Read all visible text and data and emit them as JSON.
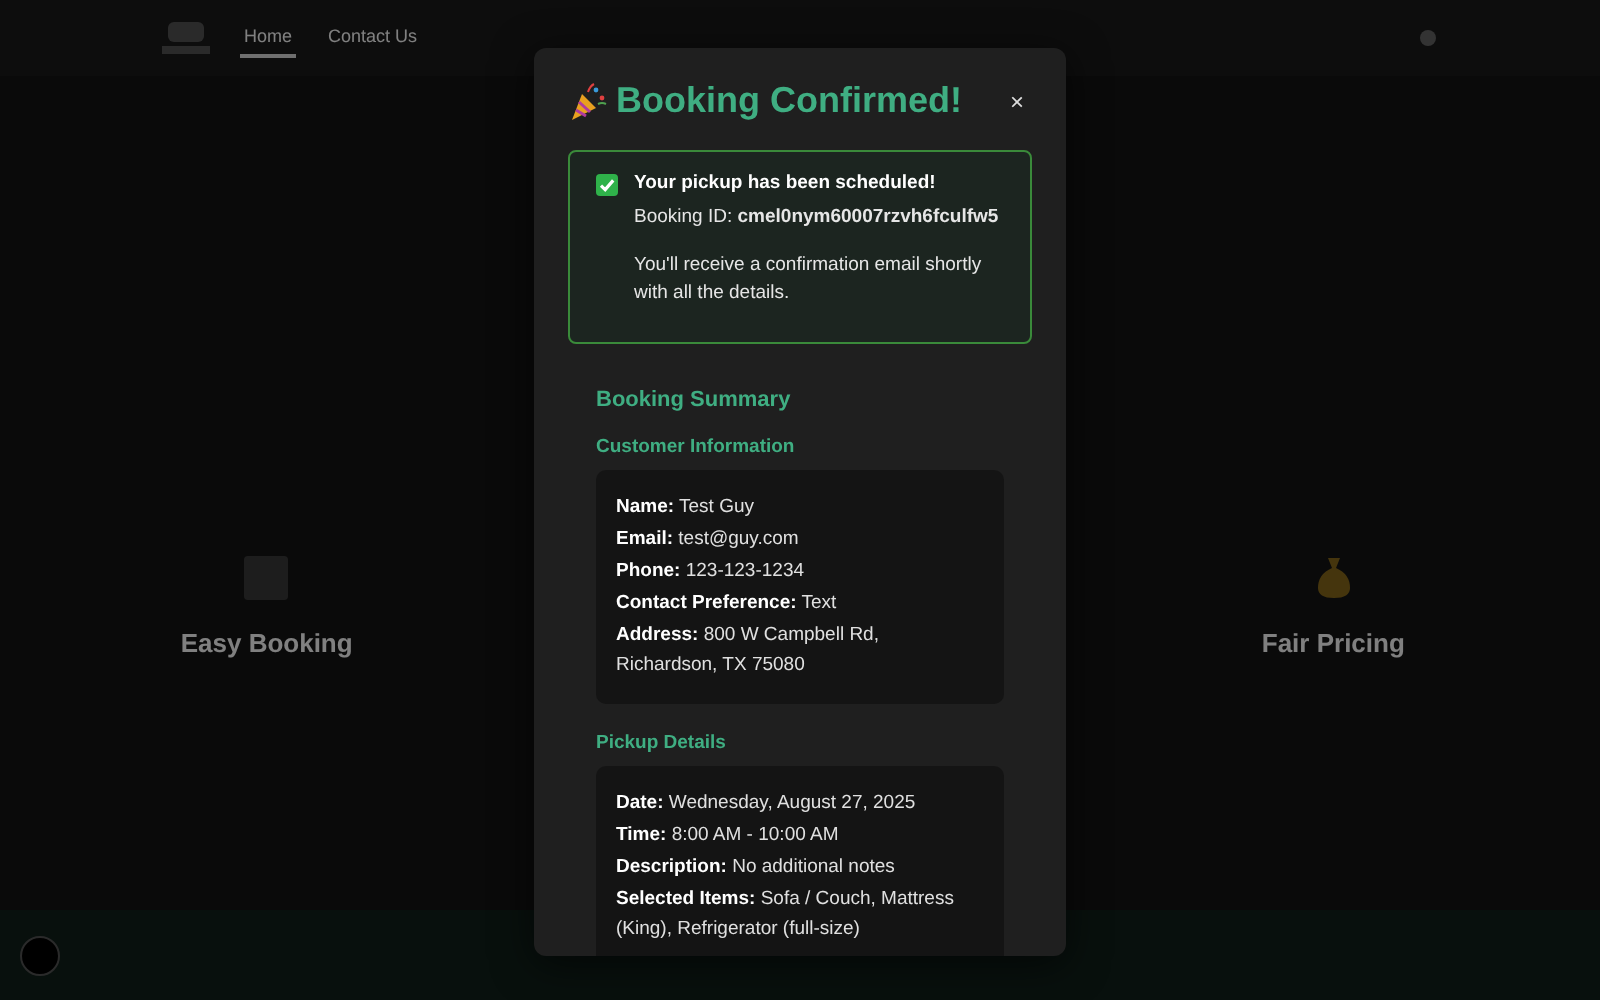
{
  "nav": {
    "links": [
      {
        "label": "Home",
        "selected": true
      },
      {
        "label": "Contact Us",
        "selected": false
      }
    ]
  },
  "features": [
    {
      "kind": "box",
      "title": "Easy Booking"
    },
    {
      "kind": "money",
      "title": "Fair Pricing"
    }
  ],
  "modal": {
    "title": "Booking Confirmed!",
    "close": "×",
    "alert": {
      "heading": "Your pickup has been scheduled!",
      "id_label": "Booking ID:",
      "id": "cmel0nym60007rzvh6fculfw5",
      "note": "You'll receive a confirmation email shortly with all the details."
    },
    "summary_title": "Booking Summary",
    "sections": [
      {
        "title": "Customer Information",
        "fields": [
          {
            "label": "Name:",
            "value": "Test Guy"
          },
          {
            "label": "Email:",
            "value": "test@guy.com"
          },
          {
            "label": "Phone:",
            "value": "123-123-1234"
          },
          {
            "label": "Contact Preference:",
            "value": "Text"
          },
          {
            "label": "Address:",
            "value": "800 W Campbell Rd, Richardson, TX 75080"
          }
        ]
      },
      {
        "title": "Pickup Details",
        "fields": [
          {
            "label": "Date:",
            "value": "Wednesday, August 27, 2025"
          },
          {
            "label": "Time:",
            "value": "8:00 AM - 10:00 AM"
          },
          {
            "label": "Description:",
            "value": "No additional notes"
          },
          {
            "label": "Selected Items:",
            "value": "Sofa / Couch, Mattress (King), Refrigerator (full-size)"
          }
        ]
      }
    ]
  }
}
